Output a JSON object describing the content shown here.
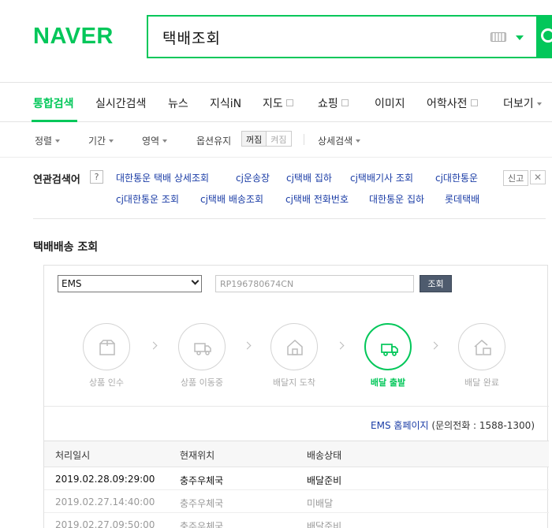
{
  "header": {
    "logo": "NAVER",
    "query": "택배조회"
  },
  "tabs": [
    {
      "label": "통합검색",
      "active": true
    },
    {
      "label": "실시간검색"
    },
    {
      "label": "뉴스"
    },
    {
      "label": "지식iN"
    },
    {
      "label": "지도"
    },
    {
      "label": "쇼핑"
    },
    {
      "label": "이미지"
    },
    {
      "label": "어학사전"
    },
    {
      "label": "더보기"
    }
  ],
  "options": {
    "sort": "정렬",
    "period": "기간",
    "area": "영역",
    "keep_option": "옵션유지",
    "toggle_on": "꺼짐",
    "toggle_off": "켜짐",
    "detail": "상세검색"
  },
  "related": {
    "label": "연관검색어",
    "help": "?",
    "report": "신고",
    "close": "✕",
    "row1": [
      "대한통운 택배 상세조회",
      "cj운송장",
      "cj택배 집하",
      "cj택배기사 조회",
      "cj대한통운"
    ],
    "row2": [
      "cj대한통운 조회",
      "cj택배 배송조회",
      "cj택배 전화번호",
      "대한통운 집하",
      "롯데택배"
    ]
  },
  "tracker": {
    "title": "택배배송 조회",
    "courier": "EMS",
    "tracking_number": "RP196780674CN",
    "lookup": "조회",
    "steps": [
      {
        "label": "상품 인수",
        "icon": "package-icon"
      },
      {
        "label": "상품 이동중",
        "icon": "truck-icon"
      },
      {
        "label": "배달지 도착",
        "icon": "house-icon"
      },
      {
        "label": "배달 출발",
        "icon": "delivery-truck-icon",
        "active": true
      },
      {
        "label": "배달 완료",
        "icon": "house-package-icon"
      }
    ],
    "homepage_link": "EMS 홈페이지",
    "contact": "(문의전화 : 1588-1300)",
    "columns": [
      "처리일시",
      "현재위치",
      "배송상태"
    ],
    "rows": [
      {
        "time": "2019.02.28.09:29:00",
        "location": "충주우체국",
        "status": "배달준비"
      },
      {
        "time": "2019.02.27.14:40:00",
        "location": "충주우체국",
        "status": "미배달"
      },
      {
        "time": "2019.02.27.09:50:00",
        "location": "충주우체국",
        "status": "배달준비"
      }
    ]
  },
  "colors": {
    "brand": "#03c75a",
    "link": "#1b3da6"
  }
}
